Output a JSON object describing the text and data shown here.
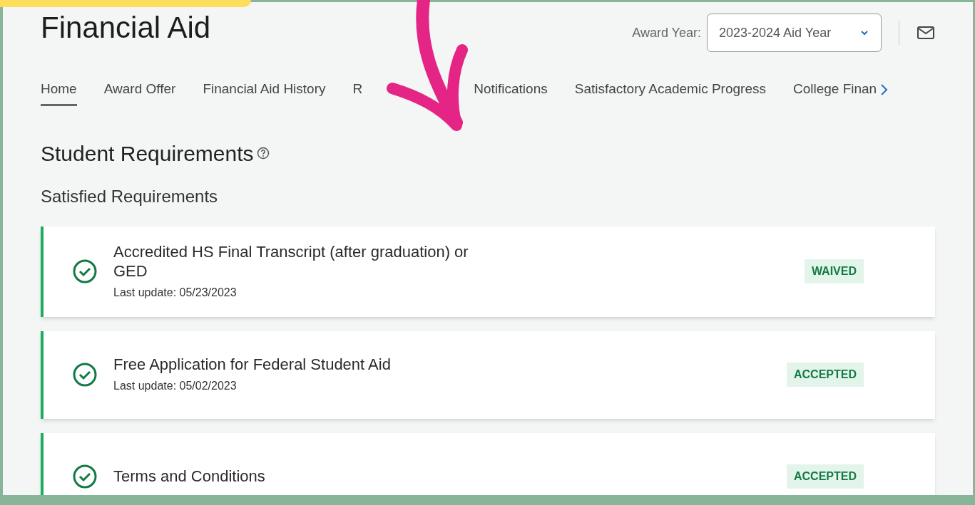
{
  "page": {
    "title": "Financial Aid"
  },
  "award_year": {
    "label": "Award Year:",
    "value": "2023-2024 Aid Year"
  },
  "tabs": [
    {
      "label": "Home",
      "selected": true
    },
    {
      "label": "Award Offer",
      "selected": false
    },
    {
      "label": "Financial Aid History",
      "selected": false
    },
    {
      "label": "R",
      "selected": false
    },
    {
      "label": "Notifications",
      "selected": false
    },
    {
      "label": "Satisfactory Academic Progress",
      "selected": false
    },
    {
      "label": "College Finan",
      "selected": false
    }
  ],
  "section": {
    "title": "Student Requirements",
    "subtitle": "Satisfied Requirements"
  },
  "requirements": [
    {
      "title": "Accredited HS Final Transcript (after graduation) or GED",
      "updated": "Last update: 05/23/2023",
      "status": "WAIVED"
    },
    {
      "title": "Free Application for Federal Student Aid",
      "updated": "Last update: 05/02/2023",
      "status": "ACCEPTED"
    },
    {
      "title": "Terms and Conditions",
      "status": "ACCEPTED"
    }
  ]
}
